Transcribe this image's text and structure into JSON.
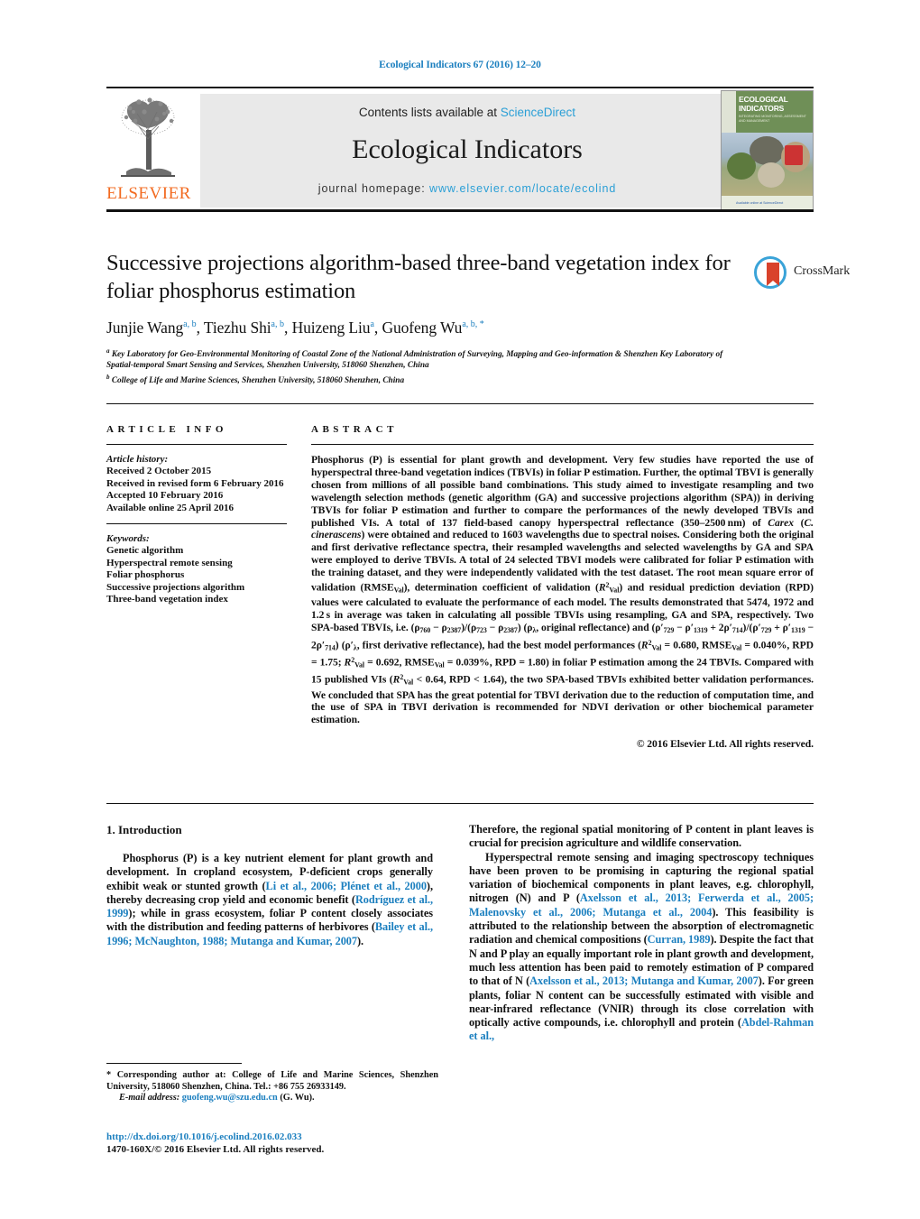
{
  "running_head": "Ecological Indicators 67 (2016) 12–20",
  "masthead": {
    "contents_line": "Contents lists available at",
    "sciencedirect": "ScienceDirect",
    "journal_title": "Ecological Indicators",
    "homepage_label": "journal homepage:",
    "homepage_url": "www.elsevier.com/locate/ecolind",
    "publisher": "ELSEVIER",
    "cover": {
      "line1": "ECOLOGICAL",
      "line2": "INDICATORS",
      "subtitle": "INTEGRATING MONITORING, ASSESSMENT AND MANAGEMENT",
      "footer": "Available online at ScienceDirect"
    }
  },
  "crossmark": {
    "label": "CrossMark"
  },
  "article": {
    "title": "Successive projections algorithm-based three-band vegetation index for foliar phosphorus estimation",
    "authors": [
      {
        "name": "Junjie Wang",
        "marks": "a, b"
      },
      {
        "name": "Tiezhu Shi",
        "marks": "a, b"
      },
      {
        "name": "Huizeng Liu",
        "marks": "a"
      },
      {
        "name": "Guofeng Wu",
        "marks": "a, b, *"
      }
    ],
    "affiliations": [
      {
        "mark": "a",
        "text": "Key Laboratory for Geo-Environmental Monitoring of Coastal Zone of the National Administration of Surveying, Mapping and Geo-information & Shenzhen Key Laboratory of Spatial-temporal Smart Sensing and Services, Shenzhen University, 518060 Shenzhen, China"
      },
      {
        "mark": "b",
        "text": "College of Life and Marine Sciences, Shenzhen University, 518060 Shenzhen, China"
      }
    ]
  },
  "article_info": {
    "heading": "ARTICLE INFO",
    "history_heading": "Article history:",
    "history": [
      "Received 2 October 2015",
      "Received in revised form 6 February 2016",
      "Accepted 10 February 2016",
      "Available online 25 April 2016"
    ],
    "keywords_heading": "Keywords:",
    "keywords": [
      "Genetic algorithm",
      "Hyperspectral remote sensing",
      "Foliar phosphorus",
      "Successive projections algorithm",
      "Three-band vegetation index"
    ]
  },
  "abstract": {
    "heading": "ABSTRACT",
    "rights": "© 2016 Elsevier Ltd. All rights reserved."
  },
  "introduction": {
    "heading": "1. Introduction"
  },
  "footnotes": {
    "corresponding_marker": "*",
    "corresponding": "Corresponding author at: College of Life and Marine Sciences, Shenzhen University, 518060 Shenzhen, China. Tel.: +86 755 26933149.",
    "email_label": "E-mail address:",
    "email": "guofeng.wu@szu.edu.cn",
    "email_owner": "(G. Wu)."
  },
  "doi_block": {
    "doi_url": "http://dx.doi.org/10.1016/j.ecolind.2016.02.033",
    "issn_line": "1470-160X/© 2016 Elsevier Ltd. All rights reserved."
  },
  "colors": {
    "link_blue": "#1b7fbf",
    "sciencedirect_blue": "#2a9fd6",
    "elsevier_orange": "#F26B21",
    "banner_grey": "#e9e9e9"
  }
}
